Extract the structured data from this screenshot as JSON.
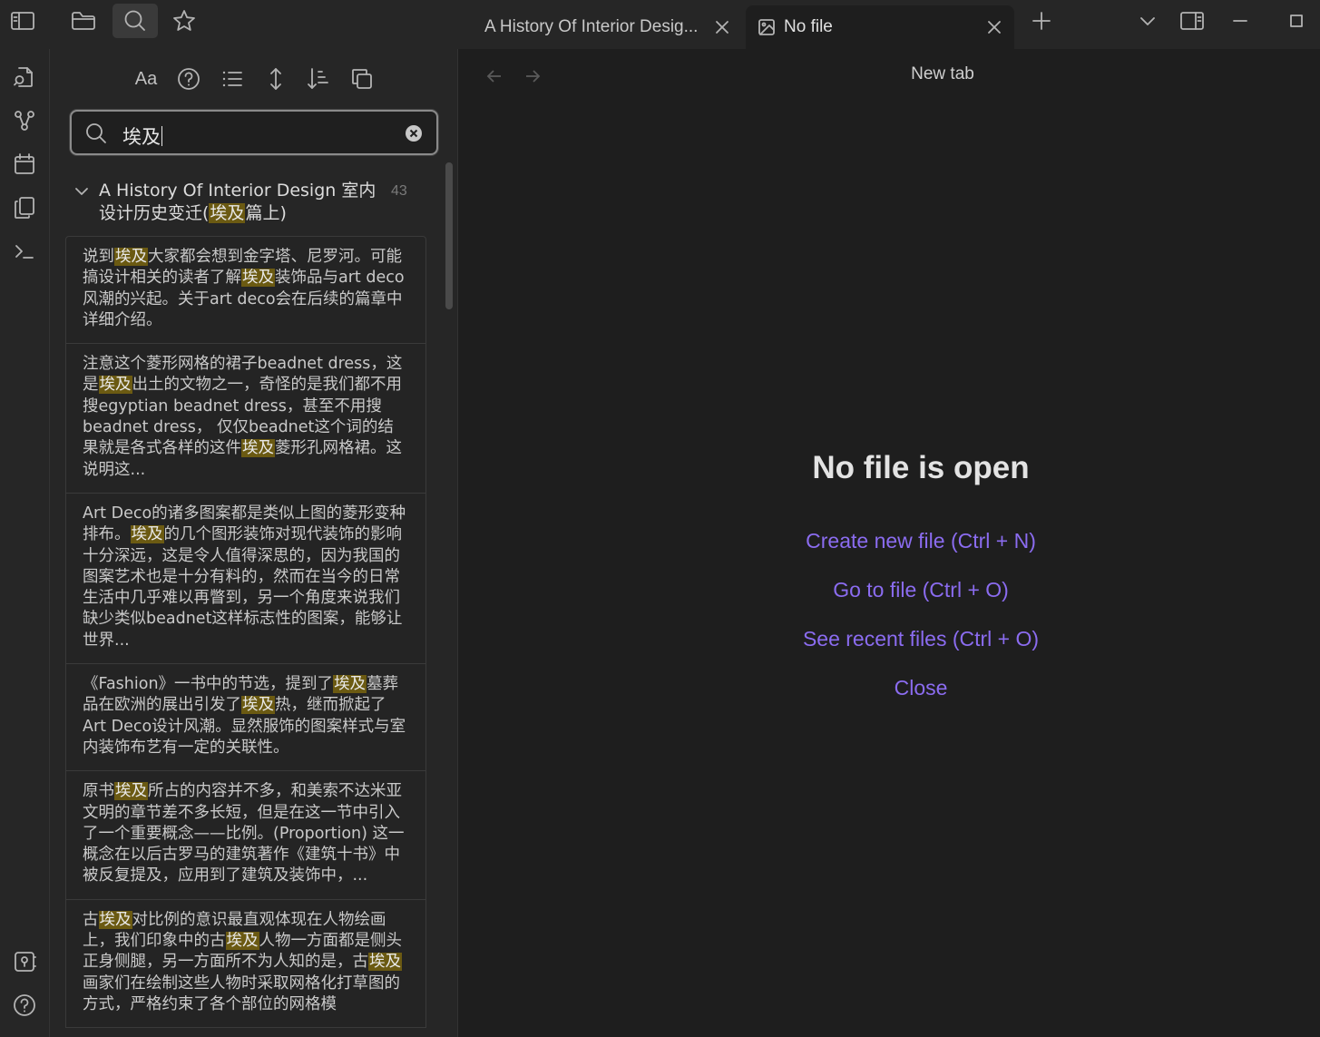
{
  "titlebar": {
    "tabs": [
      {
        "label": "A History Of Interior Desig...",
        "active": false
      },
      {
        "label": "No file",
        "active": true
      }
    ],
    "buttons": [
      "sidebar-toggle-icon",
      "folder-icon",
      "search-icon",
      "star-icon",
      "new-tab-icon",
      "chevron-down-icon",
      "right-sidebar-icon",
      "minimize-icon",
      "maximize-icon"
    ]
  },
  "ribbon": {
    "items": [
      "open-quick-switcher-icon",
      "graph-icon",
      "calendar-icon",
      "templates-icon",
      "terminal-icon",
      "vault-icon",
      "help-icon"
    ]
  },
  "search": {
    "options": {
      "match_case_label": "Aa"
    },
    "query": "埃及",
    "file": {
      "title_before": "A History Of Interior Design 室内设计历史变迁(",
      "title_match": "埃及",
      "title_after": "篇上)",
      "count": "43"
    },
    "results": [
      [
        {
          "t": "说到"
        },
        {
          "m": "埃及"
        },
        {
          "t": "大家都会想到金字塔、尼罗河。可能搞设计相关的读者了解"
        },
        {
          "m": "埃及"
        },
        {
          "t": "装饰品与art deco风潮的兴起。关于art deco会在后续的篇章中详细介绍。"
        }
      ],
      [
        {
          "t": "注意这个菱形网格的裙子beadnet dress，这是"
        },
        {
          "m": "埃及"
        },
        {
          "t": "出土的文物之一，奇怪的是我们都不用搜egyptian beadnet dress，甚至不用搜beadnet dress， 仅仅beadnet这个词的结果就是各式各样的这件"
        },
        {
          "m": "埃及"
        },
        {
          "t": "菱形孔网格裙。这说明这..."
        }
      ],
      [
        {
          "t": "Art Deco的诸多图案都是类似上图的菱形变种排布。"
        },
        {
          "m": "埃及"
        },
        {
          "t": "的几个图形装饰对现代装饰的影响十分深远，这是令人值得深思的，因为我国的图案艺术也是十分有料的，然而在当今的日常生活中几乎难以再瞥到，另一个角度来说我们缺少类似beadnet这样标志性的图案，能够让世界..."
        }
      ],
      [
        {
          "t": "《Fashion》一书中的节选，提到了"
        },
        {
          "m": "埃及"
        },
        {
          "t": "墓葬品在欧洲的展出引发了"
        },
        {
          "m": "埃及"
        },
        {
          "t": "热，继而掀起了Art Deco设计风潮。显然服饰的图案样式与室内装饰布艺有一定的关联性。"
        }
      ],
      [
        {
          "t": "原书"
        },
        {
          "m": "埃及"
        },
        {
          "t": "所占的内容并不多，和美索不达米亚文明的章节差不多长短，但是在这一节中引入了一个重要概念——比例。(Proportion) 这一概念在以后古罗马的建筑著作《建筑十书》中被反复提及，应用到了建筑及装饰中，..."
        }
      ],
      [
        {
          "t": "古"
        },
        {
          "m": "埃及"
        },
        {
          "t": "对比例的意识最直观体现在人物绘画上，我们印象中的古"
        },
        {
          "m": "埃及"
        },
        {
          "t": "人物一方面都是侧头正身侧腿，另一方面所不为人知的是，古"
        },
        {
          "m": "埃及"
        },
        {
          "t": "画家们在绘制这些人物时采取网格化打草图的方式，严格约束了各个部位的网格模"
        }
      ]
    ]
  },
  "main": {
    "view_title": "New tab",
    "empty_title": "No file is open",
    "actions": {
      "create": "Create new file (Ctrl + N)",
      "goto": "Go to file (Ctrl + O)",
      "recent": "See recent files (Ctrl + O)",
      "close": "Close"
    },
    "accent_color": "#8b6cf0",
    "highlight_color": "#6b5a12"
  }
}
